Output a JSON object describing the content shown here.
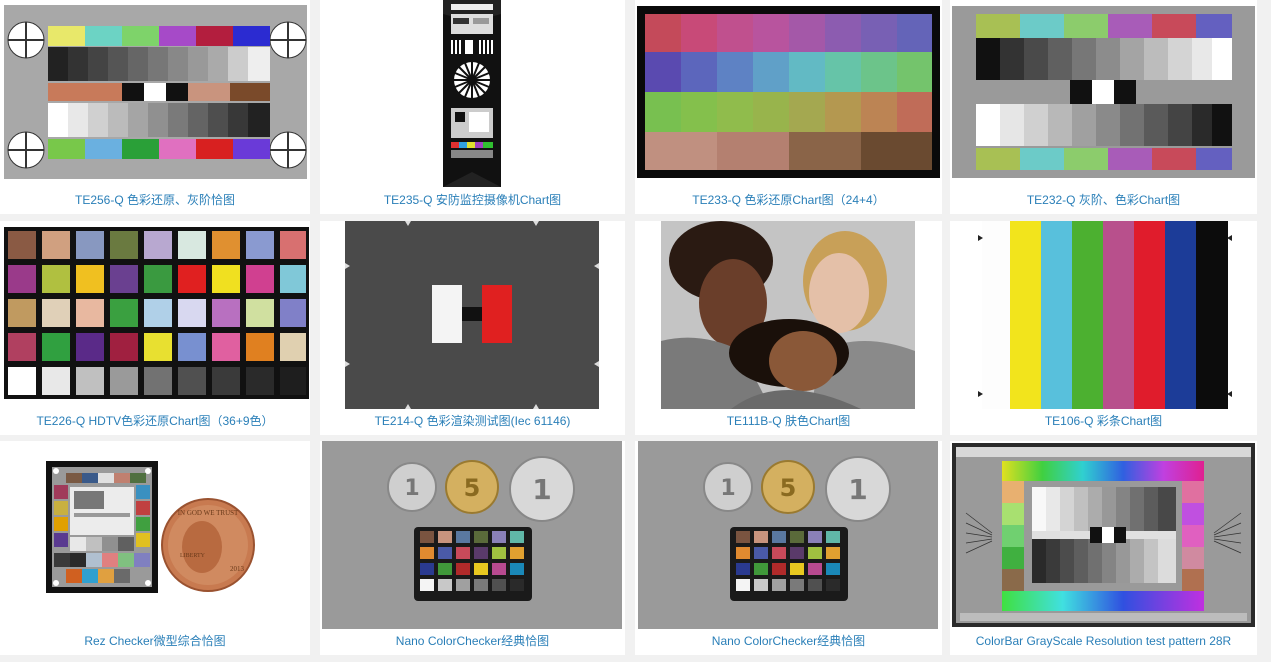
{
  "items": [
    {
      "caption": "TE256-Q 色彩还原、灰阶恰图"
    },
    {
      "caption": "TE235-Q 安防监控摄像机Chart图"
    },
    {
      "caption": "TE233-Q 色彩还原Chart图（24+4）"
    },
    {
      "caption": "TE232-Q 灰阶、色彩Chart图"
    },
    {
      "caption": "TE226-Q HDTV色彩还原Chart图（36+9色）"
    },
    {
      "caption": "TE214-Q 色彩渲染测试图(Iec 61146)"
    },
    {
      "caption": "TE111B-Q 肤色Chart图"
    },
    {
      "caption": "TE106-Q 彩条Chart图"
    },
    {
      "caption": "Rez Checker微型综合恰图"
    },
    {
      "caption": "Nano ColorChecker经典恰图"
    },
    {
      "caption": "Nano ColorChecker经典恰图"
    },
    {
      "caption": "ColorBar GrayScale Resolution test pattern 28R"
    }
  ],
  "coins": {
    "left": "1",
    "middle": "5",
    "right": "1"
  },
  "penny": {
    "motto": "IN GOD WE TRUST",
    "word": "LIBERTY",
    "year": "2013"
  },
  "colors": {
    "caption": "#2a7fb8",
    "background": "#f1f1f1"
  }
}
